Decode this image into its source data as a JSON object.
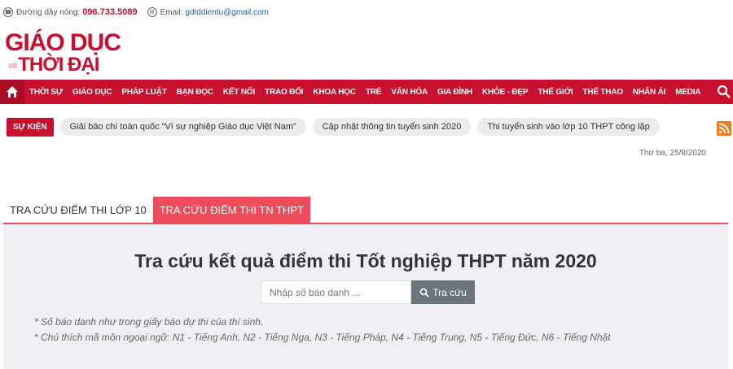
{
  "topbar": {
    "hotline_label": "Đường dây nóng:",
    "hotline_number": "096.733.5089",
    "email_label": "Email:",
    "email_value": "gdtddientu@gmail.com"
  },
  "logo": {
    "line1": "GIÁO DỤC",
    "va": "và",
    "line2": "THỜI ĐẠI"
  },
  "nav": {
    "items": [
      "THỜI SỰ",
      "GIÁO DỤC",
      "PHÁP LUẬT",
      "BẠN ĐỌC",
      "KẾT NỐI",
      "TRAO ĐỔI",
      "KHOA HỌC",
      "TRẺ",
      "VĂN HÓA",
      "GIA ĐÌNH",
      "KHỎE - ĐẸP",
      "THẾ GIỚI",
      "THỂ THAO",
      "NHÂN ÁI",
      "MEDIA"
    ]
  },
  "events": {
    "label": "SỰ KIỆN",
    "pills": [
      "Giải báo chí toàn quốc “Vì sự nghiệp Giáo dục Việt Nam”",
      "Cập nhật thông tin tuyển sinh 2020",
      "Thi tuyển sinh vào lớp 10 THPT công lập"
    ]
  },
  "date": "Thứ ba, 25/8/2020",
  "tabs": {
    "tab1": "TRA CỨU ĐIỂM THI LỚP 10",
    "tab2": "TRA CỨU ĐIỂM THI TN THPT"
  },
  "panel": {
    "title": "Tra cứu kết quả điểm thi Tốt nghiệp THPT năm 2020",
    "input_placeholder": "Nhập số báo danh ...",
    "button_label": "Tra cứu",
    "note1": "* Số báo danh như trong giấy báo dự thi của thí sinh.",
    "note2": "* Chú thích mã môn ngoại ngữ: N1 - Tiếng Anh, N2 - Tiếng Nga, N3 - Tiếng Pháp, N4 - Tiếng Trung, N5 - Tiếng Đức, N6 - Tiếng Nhật"
  },
  "colors": {
    "brand_red": "#c8102e",
    "tab_red": "#ee4c5a"
  }
}
